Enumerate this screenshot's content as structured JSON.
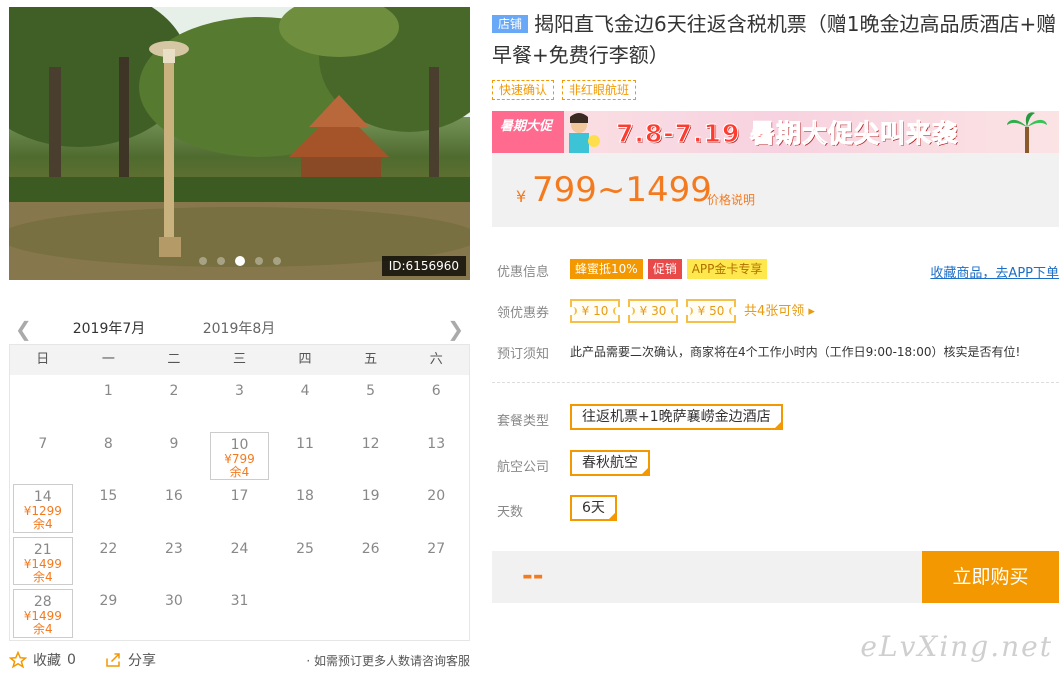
{
  "photo": {
    "id_label": "ID:6156960",
    "slide_count": 5,
    "active_slide": 2
  },
  "calendar": {
    "months": [
      "2019年7月",
      "2019年8月"
    ],
    "weekdays": [
      "日",
      "一",
      "二",
      "三",
      "四",
      "五",
      "六"
    ],
    "weeks": [
      [
        {
          "d": ""
        },
        {
          "d": "1"
        },
        {
          "d": "2"
        },
        {
          "d": "3"
        },
        {
          "d": "4"
        },
        {
          "d": "5"
        },
        {
          "d": "6"
        }
      ],
      [
        {
          "d": "7"
        },
        {
          "d": "8"
        },
        {
          "d": "9"
        },
        {
          "d": "10",
          "p": "¥799",
          "s": "余4"
        },
        {
          "d": "11"
        },
        {
          "d": "12"
        },
        {
          "d": "13"
        }
      ],
      [
        {
          "d": "14",
          "p": "¥1299",
          "s": "余4"
        },
        {
          "d": "15"
        },
        {
          "d": "16"
        },
        {
          "d": "17"
        },
        {
          "d": "18"
        },
        {
          "d": "19"
        },
        {
          "d": "20"
        }
      ],
      [
        {
          "d": "21",
          "p": "¥1499",
          "s": "余4"
        },
        {
          "d": "22"
        },
        {
          "d": "23"
        },
        {
          "d": "24"
        },
        {
          "d": "25"
        },
        {
          "d": "26"
        },
        {
          "d": "27"
        }
      ],
      [
        {
          "d": "28",
          "p": "¥1499",
          "s": "余4"
        },
        {
          "d": "29"
        },
        {
          "d": "30"
        },
        {
          "d": "31"
        },
        {
          "d": ""
        },
        {
          "d": ""
        },
        {
          "d": ""
        }
      ]
    ]
  },
  "footer": {
    "favorite_label": "收藏",
    "favorite_count": "0",
    "share_label": "分享",
    "note": "· 如需预订更多人数请咨询客服"
  },
  "product": {
    "shop_tag": "店铺",
    "title": "揭阳直飞金边6天往返含税机票（赠1晚金边高品质酒店+赠早餐+免费行李额）",
    "tags": [
      "快速确认",
      "非红眼航班"
    ]
  },
  "banner": {
    "badge": "暑期大促",
    "text": "7.8-7.19 暑期大促尖叫来袭"
  },
  "price": {
    "currency": "¥",
    "range": "799~1499",
    "help": "价格说明"
  },
  "discount": {
    "label": "优惠信息",
    "badges": [
      "蜂蜜抵10%",
      "促销",
      "APP金卡专享"
    ],
    "fav_link": "收藏商品，去APP下单"
  },
  "coupons": {
    "label": "领优惠券",
    "items": [
      "¥ 10",
      "¥ 30",
      "¥ 50"
    ],
    "more": "共4张可领 ▸"
  },
  "notice": {
    "label": "预订须知",
    "text": "此产品需要二次确认，商家将在4个工作小时内（工作日9:00-18:00）核实是否有位!"
  },
  "options": {
    "package_label": "套餐类型",
    "package_value": "往返机票+1晚萨襄崂金边酒店",
    "airline_label": "航空公司",
    "airline_value": "春秋航空",
    "days_label": "天数",
    "days_value": "6天"
  },
  "buy": {
    "total": "--",
    "button": "立即购买"
  },
  "watermark": "eLvXing.net",
  "colors": {
    "accent": "#f39800",
    "price": "#f47a1f",
    "link": "#1c6ec6"
  }
}
